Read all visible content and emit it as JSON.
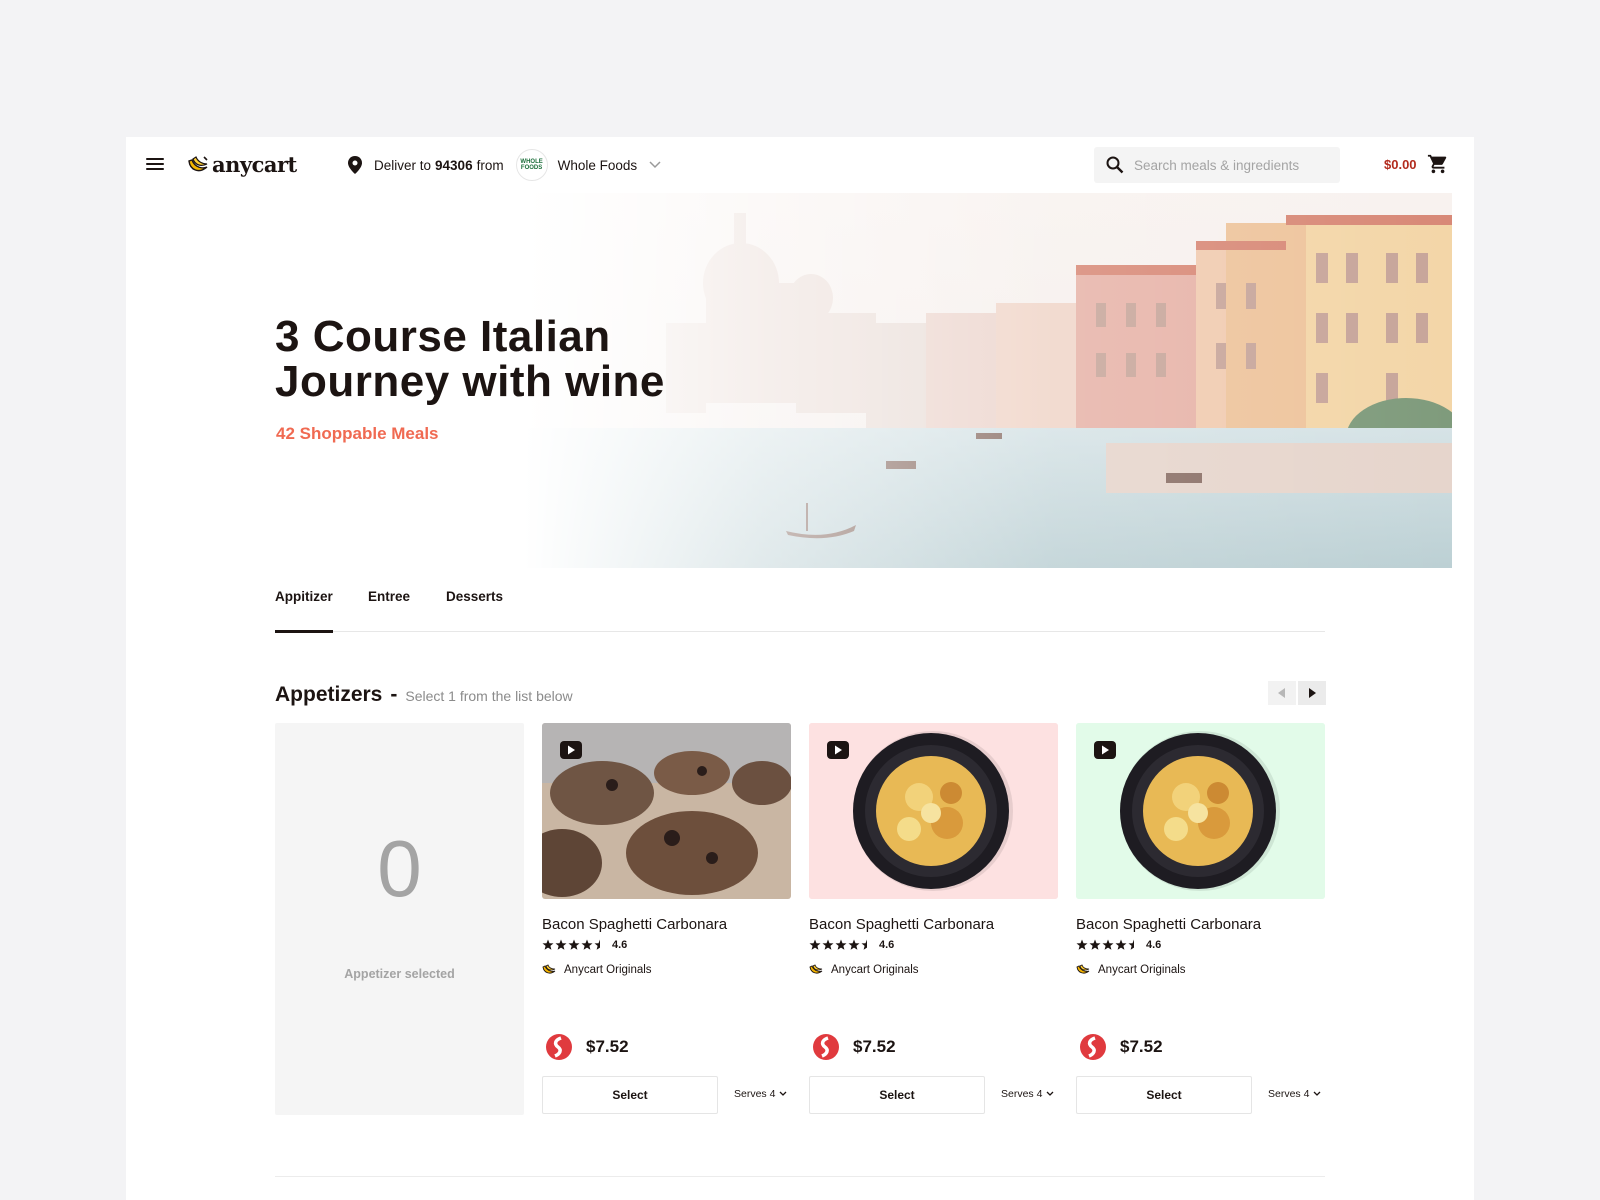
{
  "header": {
    "logo_text": "anycart",
    "deliver_prefix": "Deliver to",
    "zip": "94306",
    "deliver_suffix": "from",
    "store_logo_text": "WHOLE FOODS",
    "store_name": "Whole Foods",
    "search_placeholder": "Search meals & ingredients",
    "cart_total": "$0.00",
    "icons": [
      "menu-icon",
      "logo-banana-icon",
      "location-pin-icon",
      "chevron-down-icon",
      "search-icon",
      "cart-icon"
    ]
  },
  "hero": {
    "title": "3 Course Italian Journey with wine",
    "count_label": "42 Shoppable Meals"
  },
  "tabs": [
    {
      "label": "Appitizer",
      "active": true
    },
    {
      "label": "Entree",
      "active": false
    },
    {
      "label": "Desserts",
      "active": false
    }
  ],
  "section": {
    "title": "Appetizers",
    "dash": "-",
    "subtitle": "Select 1 from the list below"
  },
  "selected": {
    "count": "0",
    "label": "Appetizer selected"
  },
  "meals": [
    {
      "name": "Bacon Spaghetti Carbonara",
      "rating": "4.6",
      "stars": 4.5,
      "brand": "Anycart Originals",
      "price": "$7.52",
      "select_label": "Select",
      "serves_label": "Serves 4",
      "image_bg": "#c9b6a3"
    },
    {
      "name": "Bacon Spaghetti Carbonara",
      "rating": "4.6",
      "stars": 4.5,
      "brand": "Anycart Originals",
      "price": "$7.52",
      "select_label": "Select",
      "serves_label": "Serves 4",
      "image_bg": "#fde1e1"
    },
    {
      "name": "Bacon Spaghetti Carbonara",
      "rating": "4.6",
      "stars": 4.5,
      "brand": "Anycart Originals",
      "price": "$7.52",
      "select_label": "Select",
      "serves_label": "Serves 4",
      "image_bg": "#e2fbe9"
    }
  ],
  "colors": {
    "accent": "#f06a52",
    "cart_total": "#b22b1d",
    "text": "#1c1412",
    "store_badge": "#e03a3e"
  }
}
